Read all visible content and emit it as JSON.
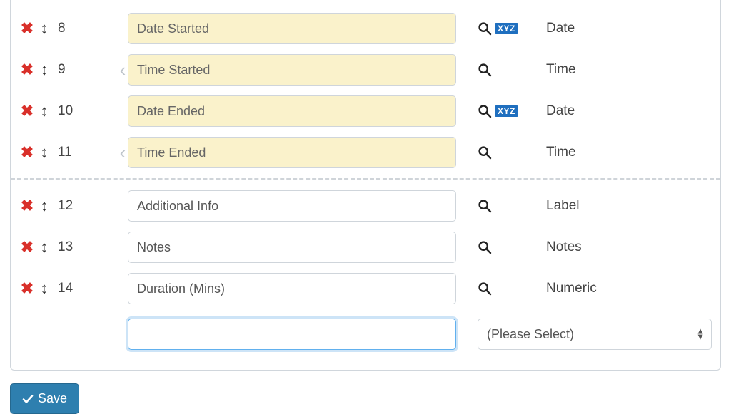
{
  "rows": [
    {
      "num": "8",
      "label": "Date Started",
      "type": "Date",
      "yellow": true,
      "xyz": true,
      "caret": false
    },
    {
      "num": "9",
      "label": "Time Started",
      "type": "Time",
      "yellow": true,
      "xyz": false,
      "caret": true
    },
    {
      "num": "10",
      "label": "Date Ended",
      "type": "Date",
      "yellow": true,
      "xyz": true,
      "caret": false
    },
    {
      "num": "11",
      "label": "Time Ended",
      "type": "Time",
      "yellow": true,
      "xyz": false,
      "caret": true
    },
    {
      "num": "12",
      "label": "Additional Info",
      "type": "Label",
      "yellow": false,
      "xyz": false,
      "caret": false,
      "afterSep": true
    },
    {
      "num": "13",
      "label": "Notes",
      "type": "Notes",
      "yellow": false,
      "xyz": false,
      "caret": false
    },
    {
      "num": "14",
      "label": "Duration (Mins)",
      "type": "Numeric",
      "yellow": false,
      "xyz": false,
      "caret": false
    }
  ],
  "xyz_badge_text": "XYZ",
  "new_row": {
    "value": ""
  },
  "type_select": {
    "placeholder": "(Please Select)"
  },
  "save_button": {
    "label": "Save"
  }
}
